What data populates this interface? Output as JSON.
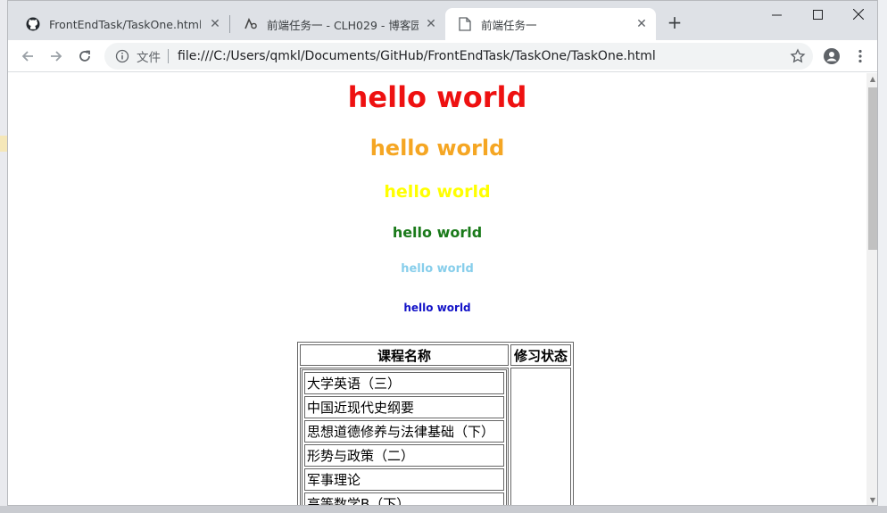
{
  "tabs": [
    {
      "title": "FrontEndTask/TaskOne.html at",
      "icon": "github-icon"
    },
    {
      "title": "前端任务一 - CLH029 - 博客园",
      "icon": "cnblogs-icon"
    },
    {
      "title": "前端任务一",
      "icon": "document-icon"
    }
  ],
  "omnibox": {
    "label": "文件",
    "url": "file:///C:/Users/qmkl/Documents/GitHub/FrontEndTask/TaskOne/TaskOne.html"
  },
  "headings": [
    {
      "text": "hello world",
      "color": "#ee1111"
    },
    {
      "text": "hello world",
      "color": "#f5a623"
    },
    {
      "text": "hello world",
      "color": "#ffff00"
    },
    {
      "text": "hello world",
      "color": "#1a7a1a"
    },
    {
      "text": "hello world",
      "color": "#87ceeb"
    },
    {
      "text": "hello world",
      "color": "#1414c8"
    }
  ],
  "table": {
    "headers": [
      "课程名称",
      "修习状态"
    ],
    "courses": [
      "大学英语（三）",
      "中国近现代史纲要",
      "思想道德修养与法律基础（下）",
      "形势与政策（二）",
      "军事理论",
      "高等数学B（下）"
    ]
  }
}
